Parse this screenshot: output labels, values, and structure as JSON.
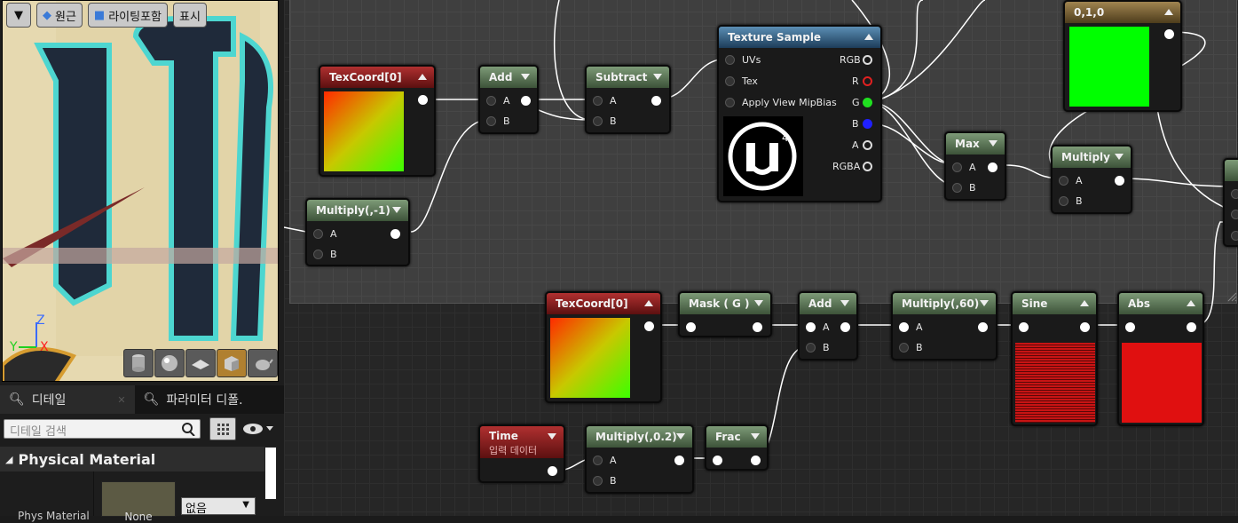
{
  "viewport": {
    "toolbar": {
      "original_label": "원근",
      "lighting_label": "라이팅포함",
      "show_label": "표시"
    },
    "axes": {
      "z": "Z",
      "y": "Y",
      "x": "X"
    },
    "preview_shapes": [
      "cylinder-icon",
      "sphere-icon",
      "plane-icon",
      "cube-icon",
      "teapot-icon"
    ]
  },
  "details_panel": {
    "tabs": [
      {
        "label": "디테일"
      },
      {
        "label": "파라미터 디폴."
      }
    ],
    "search_placeholder": "디테일 검색",
    "section_title": "Physical Material",
    "property": {
      "name": "Phys Material",
      "value": "None",
      "dropdown_value": "없음"
    }
  },
  "nodes": {
    "texcoord1": {
      "title": "TexCoord[0]"
    },
    "add1": {
      "title": "Add",
      "in_a": "A",
      "in_b": "B"
    },
    "subtract": {
      "title": "Subtract",
      "in_a": "A",
      "in_b": "B"
    },
    "multiply_neg1": {
      "title": "Multiply(,-1)",
      "in_a": "A",
      "in_b": "B"
    },
    "texsample": {
      "title": "Texture Sample",
      "inputs": [
        "UVs",
        "Tex",
        "Apply View MipBias"
      ],
      "outputs": [
        "RGB",
        "R",
        "G",
        "B",
        "A",
        "RGBA"
      ]
    },
    "constant": {
      "title": "0,1,0"
    },
    "max": {
      "title": "Max",
      "in_a": "A",
      "in_b": "B"
    },
    "multiply1": {
      "title": "Multiply",
      "in_a": "A",
      "in_b": "B"
    },
    "texcoord2": {
      "title": "TexCoord[0]"
    },
    "mask": {
      "title": "Mask ( G )"
    },
    "add2": {
      "title": "Add",
      "in_a": "A",
      "in_b": "B"
    },
    "multiply60": {
      "title": "Multiply(,60)",
      "in_a": "A",
      "in_b": "B"
    },
    "sine": {
      "title": "Sine"
    },
    "abs": {
      "title": "Abs"
    },
    "time": {
      "title": "Time",
      "subtitle": "입력 데이터"
    },
    "multiply02": {
      "title": "Multiply(,0.2)",
      "in_a": "A",
      "in_b": "B"
    },
    "frac": {
      "title": "Frac"
    }
  },
  "colors": {
    "constant_green": "#00ff00",
    "sine_red": "#c81414",
    "abs_red": "#e01010"
  }
}
